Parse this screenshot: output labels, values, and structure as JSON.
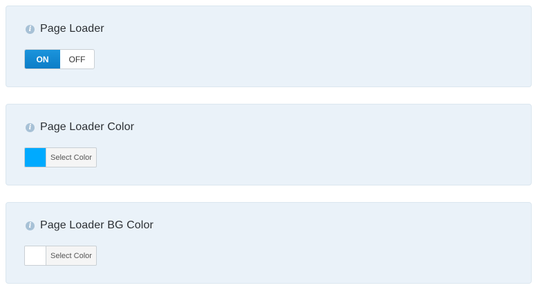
{
  "panels": [
    {
      "title": "Page Loader",
      "toggle": {
        "on_label": "ON",
        "off_label": "OFF",
        "state": "ON"
      }
    },
    {
      "title": "Page Loader Color",
      "picker": {
        "label": "Select Color",
        "color": "#00aaff"
      }
    },
    {
      "title": "Page Loader BG Color",
      "picker": {
        "label": "Select Color",
        "color": "#ffffff"
      }
    }
  ],
  "info_icon_glyph": "i",
  "colors": {
    "panel_bg": "#eaf2f9",
    "toggle_on": "#0c7dc7"
  }
}
